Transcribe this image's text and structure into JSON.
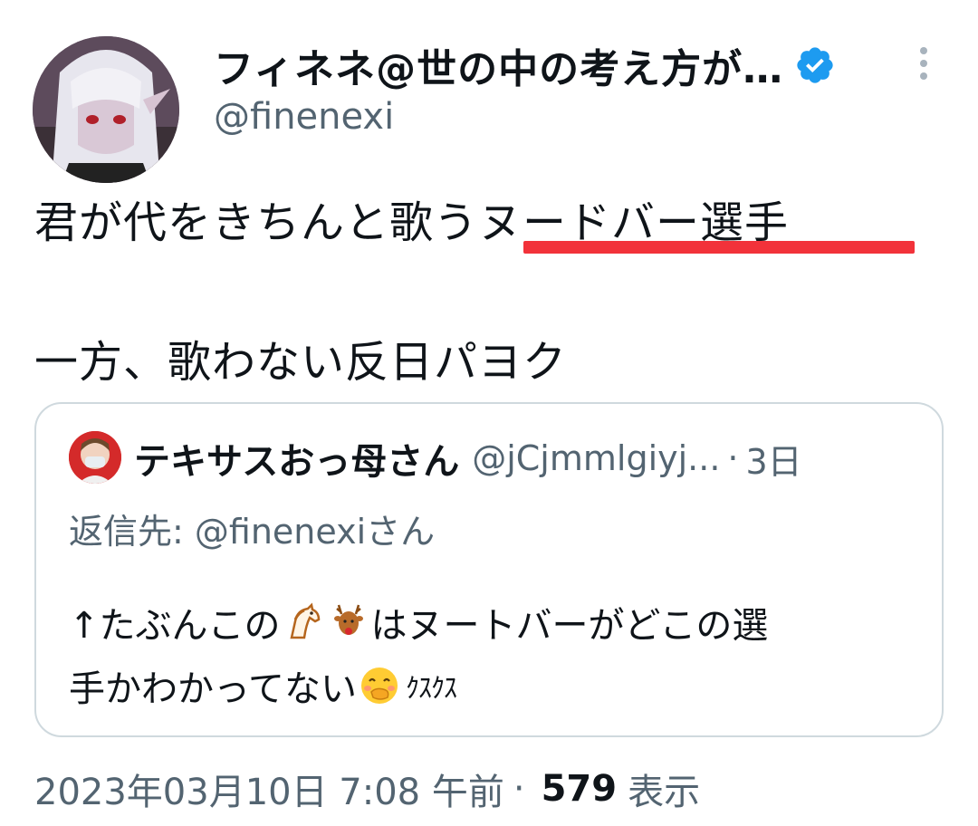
{
  "author": {
    "display_name": "フィネネ@世の中の考え方が…",
    "username": "@finenexi",
    "verified_icon": "verified-badge-icon",
    "accent": "#1d9bf0"
  },
  "tweet": {
    "line1": "君が代をきちんと歌うヌードバー選手",
    "line2": "一方、歌わない反日パヨク",
    "underline_color": "#f2323a"
  },
  "quote": {
    "display_name": "テキサスおっ母さん",
    "username": "@jCjmmlgiyj...",
    "separator": "·",
    "time": "3日",
    "reply_prefix": "返信先: ",
    "reply_mention": "@finenexi",
    "reply_suffix": "さん",
    "text_line1_a": "↑たぶんこの",
    "text_line1_b": "はヌートバーがどこの選",
    "text_line2_a": "手かわかってない",
    "text_line2_kusu": "ｸｽｸｽ",
    "emojis": [
      "horse-face-icon",
      "deer-icon",
      "hand-over-mouth-face-icon"
    ]
  },
  "footer": {
    "datetime": "2023年03月10日 7:08 午前",
    "separator": "·",
    "views_count": "579",
    "views_label": "表示"
  },
  "colors": {
    "text_primary": "#0f1419",
    "text_secondary": "#536471",
    "border": "#cfd9de"
  }
}
